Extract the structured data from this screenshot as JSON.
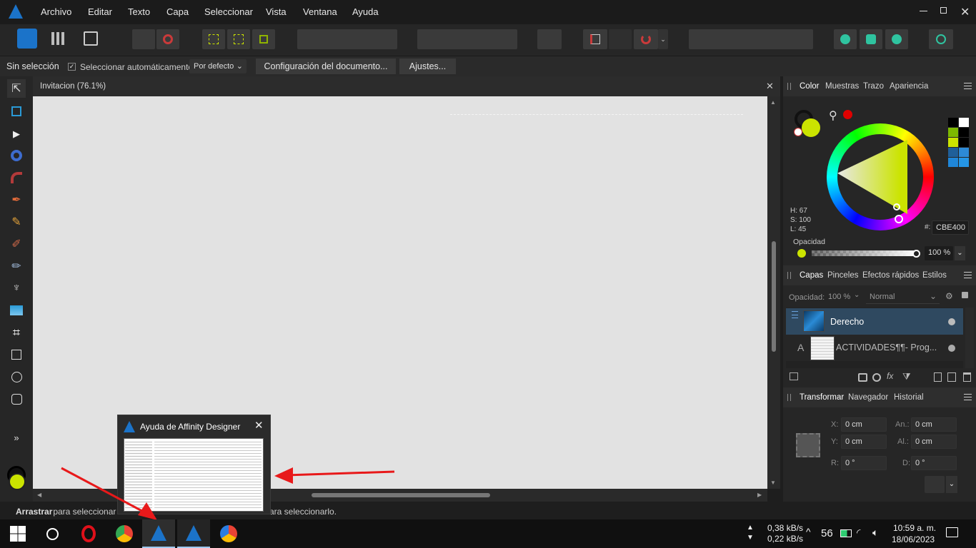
{
  "menu": [
    "Archivo",
    "Editar",
    "Texto",
    "Capa",
    "Seleccionar",
    "Vista",
    "Ventana",
    "Ayuda"
  ],
  "context": {
    "no_selection": "Sin selección",
    "auto_select_label": "Seleccionar automáticamente:",
    "auto_select_value": "Por defecto",
    "doc_setup": "Configuración del documento...",
    "settings": "Ajustes..."
  },
  "document": {
    "tab_title": "Invitacion (76.1%)"
  },
  "color_panel": {
    "tabs": [
      "Color",
      "Muestras",
      "Trazo",
      "Apariencia"
    ],
    "h": "H: 67",
    "s": "S: 100",
    "l": "L: 45",
    "hex_label": "#:",
    "hex": "CBE400",
    "opacity_label": "Opacidad",
    "opacity_value": "100 %",
    "current_color": "#cbe400",
    "swatches": [
      "#000000",
      "#ffffff",
      "#7db900",
      "#000000",
      "#cbe400",
      "#000000",
      "#1f5f99",
      "#2d8ad6",
      "#1f86d8",
      "#2596e6"
    ]
  },
  "layers_panel": {
    "tabs": [
      "Capas",
      "Pinceles",
      "Efectos rápidos",
      "Estilos"
    ],
    "opacity_label": "Opacidad:",
    "opacity_value": "100 %",
    "blend": "Normal",
    "layers": [
      {
        "name": "Derecho",
        "selected": true
      },
      {
        "name": "ACTIVIDADES¶¶- Prog...",
        "selected": false
      }
    ]
  },
  "transform_panel": {
    "tabs": [
      "Transformar",
      "Navegador",
      "Historial"
    ],
    "x_label": "X:",
    "x": "0 cm",
    "w_label": "An.:",
    "w": "0 cm",
    "y_label": "Y:",
    "y": "0 cm",
    "h_label": "Al.:",
    "h": "0 cm",
    "r_label": "R:",
    "r": "0 °",
    "s_label": "D:",
    "s": "0 °"
  },
  "status": {
    "bold": "Arrastrar",
    "text": " para seleccionar",
    "tail": "ara seleccionarlo."
  },
  "popup": {
    "title": "Ayuda de Affinity Designer"
  },
  "tray": {
    "upload": "0,38 kB/s",
    "download": "0,22 kB/s",
    "count": "56",
    "time": "10:59 a. m.",
    "date": "18/06/2023"
  },
  "tools_more": "»"
}
